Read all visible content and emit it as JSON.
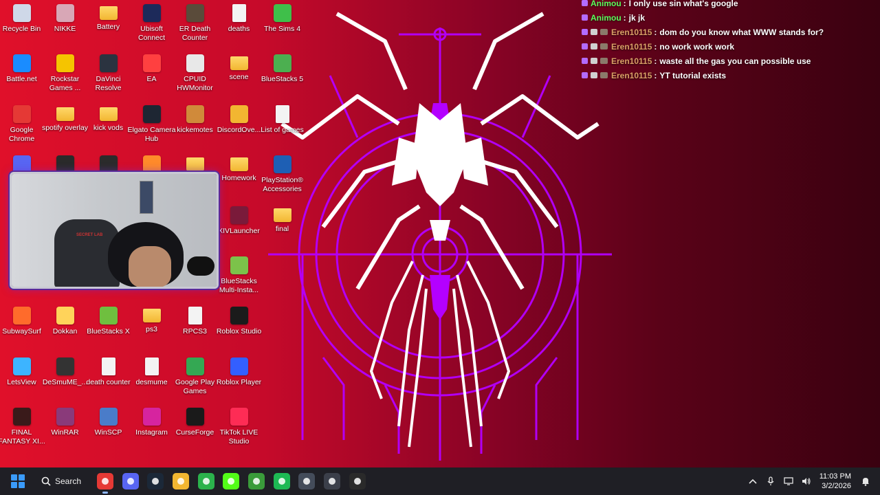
{
  "desktop_icons": [
    {
      "label": "Recycle Bin",
      "icon": "recycle-bin-icon",
      "color": "#cfd8e8"
    },
    {
      "label": "NIKKE",
      "icon": "nikke-icon",
      "color": "#d8a7b6"
    },
    {
      "label": "Battery",
      "icon": "folder-icon",
      "color": "#f2b631"
    },
    {
      "label": "Ubisoft Connect",
      "icon": "ubisoft-icon",
      "color": "#1d2a5a"
    },
    {
      "label": "ER Death Counter",
      "icon": "er-death-counter-icon",
      "color": "#5a4b3a"
    },
    {
      "label": "deaths",
      "icon": "file-icon",
      "color": "#f3f3f3"
    },
    {
      "label": "The Sims 4",
      "icon": "sims-icon",
      "color": "#3fbf4a"
    },
    {
      "label": "Battle.net",
      "icon": "battlenet-icon",
      "color": "#1a8cff"
    },
    {
      "label": "Rockstar Games ...",
      "icon": "rockstar-icon",
      "color": "#f5c400"
    },
    {
      "label": "DaVinci Resolve",
      "icon": "davinci-icon",
      "color": "#2b3340"
    },
    {
      "label": "EA",
      "icon": "ea-icon",
      "color": "#ff4040"
    },
    {
      "label": "CPUID HWMonitor",
      "icon": "cpuid-icon",
      "color": "#e8e8e8"
    },
    {
      "label": "scene",
      "icon": "folder-icon",
      "color": "#f2b631"
    },
    {
      "label": "BlueStacks 5",
      "icon": "bluestacks-icon",
      "color": "#4caf50"
    },
    {
      "label": "Google Chrome",
      "icon": "chrome-icon",
      "color": "#e53935"
    },
    {
      "label": "spotify overlay",
      "icon": "folder-icon",
      "color": "#f2b631"
    },
    {
      "label": "kick vods",
      "icon": "folder-icon",
      "color": "#f2b631"
    },
    {
      "label": "Elgato Camera Hub",
      "icon": "elgato-icon",
      "color": "#1e2633"
    },
    {
      "label": "kickemotes",
      "icon": "kickemotes-icon",
      "color": "#d08a3a"
    },
    {
      "label": "DiscordOve...",
      "icon": "discord-overlay-icon",
      "color": "#f2b631"
    },
    {
      "label": "List of games",
      "icon": "file-icon",
      "color": "#f3f3f3"
    },
    {
      "label": "",
      "icon": "discord-icon",
      "color": "#5865f2"
    },
    {
      "label": "",
      "icon": "epic-icon",
      "color": "#2a2a2a"
    },
    {
      "label": "",
      "icon": "folder-dark-icon",
      "color": "#2b2b2b"
    },
    {
      "label": "",
      "icon": "app-orange-icon",
      "color": "#ff8a2a"
    },
    {
      "label": "",
      "icon": "folder-icon",
      "color": "#f2b631"
    },
    {
      "label": "Homework",
      "icon": "folder-icon",
      "color": "#f2b631"
    },
    {
      "label": "PlayStation® Accessories",
      "icon": "playstation-icon",
      "color": "#1e5fb4"
    },
    {
      "label": "XIVLauncher",
      "icon": "xivlauncher-icon",
      "color": "#7a1a3a"
    },
    {
      "label": "final",
      "icon": "folder-icon",
      "color": "#f2b631"
    },
    {
      "label": "BlueStacks Multi-Insta...",
      "icon": "bluestacks-multi-icon",
      "color": "#7cc24a"
    },
    {
      "label": "SubwaySurf",
      "icon": "subwaysurf-icon",
      "color": "#ff6b2b"
    },
    {
      "label": "Dokkan",
      "icon": "dokkan-icon",
      "color": "#ffd35a"
    },
    {
      "label": "BlueStacks X",
      "icon": "bluestacks-x-icon",
      "color": "#6fbf3f"
    },
    {
      "label": "ps3",
      "icon": "folder-icon",
      "color": "#f2b631"
    },
    {
      "label": "RPCS3",
      "icon": "file-icon",
      "color": "#f3f3f3"
    },
    {
      "label": "Roblox Studio",
      "icon": "roblox-studio-icon",
      "color": "#1b1b1b"
    },
    {
      "label": "LetsView",
      "icon": "letsview-icon",
      "color": "#3db4ff"
    },
    {
      "label": "DeSmuME_...",
      "icon": "desmume-icon",
      "color": "#333333"
    },
    {
      "label": "death counter",
      "icon": "file-icon",
      "color": "#f3f3f3"
    },
    {
      "label": "desmume",
      "icon": "file-icon",
      "color": "#f3f3f3"
    },
    {
      "label": "Google Play Games",
      "icon": "play-games-icon",
      "color": "#34a853"
    },
    {
      "label": "Roblox Player",
      "icon": "roblox-player-icon",
      "color": "#335fff"
    },
    {
      "label": "FINAL FANTASY XI...",
      "icon": "final-fantasy-icon",
      "color": "#3a1a1a"
    },
    {
      "label": "WinRAR",
      "icon": "winrar-icon",
      "color": "#8a3a7a"
    },
    {
      "label": "WinSCP",
      "icon": "winscp-icon",
      "color": "#4a7cc9"
    },
    {
      "label": "Instagram",
      "icon": "instagram-icon",
      "color": "#d6249f"
    },
    {
      "label": "CurseForge",
      "icon": "curseforge-icon",
      "color": "#1a1a1a"
    },
    {
      "label": "TikTok LIVE Studio",
      "icon": "tiktok-live-icon",
      "color": "#fe2c55"
    }
  ],
  "chat": {
    "messages": [
      {
        "user": "Animou",
        "text": "I only use sin what's google",
        "user_color": "#5cff5c",
        "badges": 1
      },
      {
        "user": "Animou",
        "text": "jk jk",
        "user_color": "#5cff5c",
        "badges": 1
      },
      {
        "user": "Eren10115",
        "text": "dom do you know what WWW stands for?",
        "user_color": "#d9a066",
        "badges": 3
      },
      {
        "user": "Eren10115",
        "text": "no work work work",
        "user_color": "#d9a066",
        "badges": 3
      },
      {
        "user": "Eren10115",
        "text": "waste all the gas you can possible use",
        "user_color": "#d9a066",
        "badges": 3
      },
      {
        "user": "Eren10115",
        "text": "YT tutorial exists",
        "user_color": "#d9a066",
        "badges": 3
      }
    ]
  },
  "webcam": {
    "chair_badge": "SECRET LAB"
  },
  "taskbar": {
    "search_label": "Search",
    "apps": [
      {
        "name": "chrome",
        "icon": "chrome-icon",
        "color": "#e53935",
        "active": true
      },
      {
        "name": "discord",
        "icon": "discord-icon",
        "color": "#5865f2",
        "active": false
      },
      {
        "name": "steam",
        "icon": "steam-icon",
        "color": "#1b2838",
        "active": false
      },
      {
        "name": "file-explorer",
        "icon": "folder-icon",
        "color": "#f2b631",
        "active": false
      },
      {
        "name": "xbox-app",
        "icon": "xbox-app-icon",
        "color": "#2bb24c",
        "active": false
      },
      {
        "name": "kick",
        "icon": "kick-icon",
        "color": "#53fc18",
        "active": false
      },
      {
        "name": "xbox",
        "icon": "xbox-icon",
        "color": "#3a9b3a",
        "active": false
      },
      {
        "name": "spotify",
        "icon": "spotify-icon",
        "color": "#1db954",
        "active": false
      },
      {
        "name": "elgato-camera-hub",
        "icon": "elgato-icon",
        "color": "#444c5a",
        "active": false
      },
      {
        "name": "calculator",
        "icon": "calculator-icon",
        "color": "#3b3f4a",
        "active": false
      },
      {
        "name": "obs",
        "icon": "obs-icon",
        "color": "#2a2a2a",
        "active": false
      }
    ],
    "clock_time": "11:03 PM",
    "clock_date": "3/2/2026"
  }
}
